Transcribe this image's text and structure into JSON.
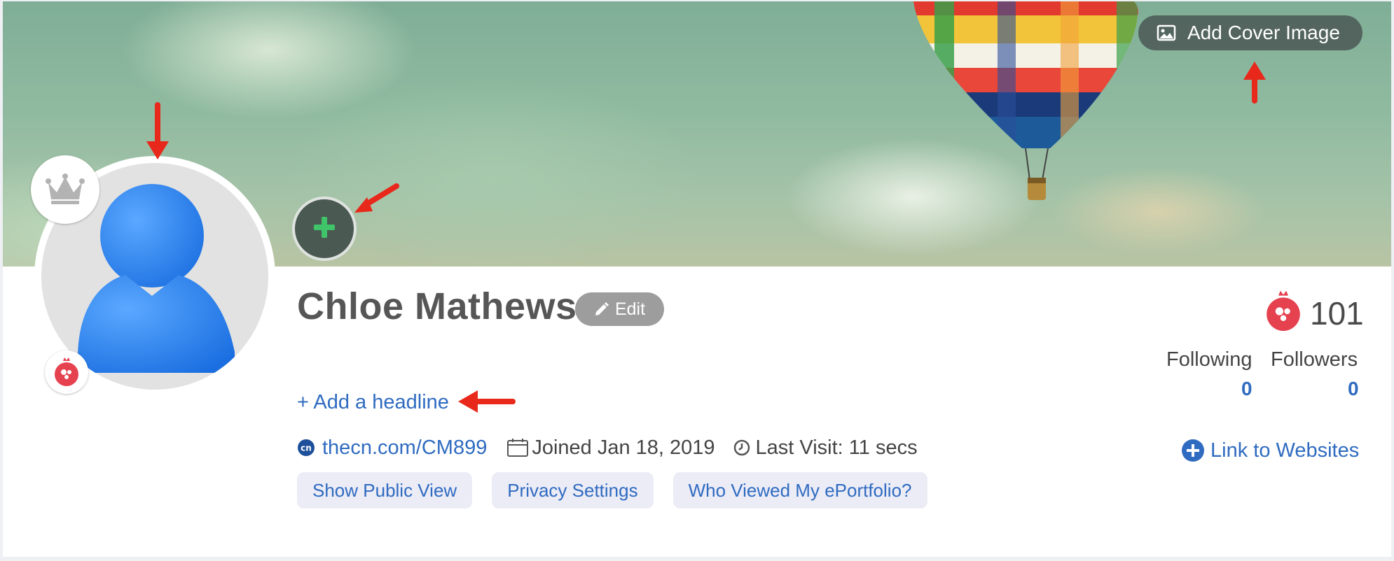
{
  "cover": {
    "add_cover_label": "Add Cover Image"
  },
  "profile": {
    "name": "Chloe Mathews",
    "edit_label": "Edit",
    "headline_label": "+ Add a headline",
    "url": "thecn.com/CM899",
    "joined": "Joined Jan 18, 2019",
    "last_visit": "Last Visit: 11 secs"
  },
  "actions": {
    "public_view": "Show Public View",
    "privacy": "Privacy Settings",
    "who_viewed": "Who Viewed My ePortfolio?"
  },
  "stats": {
    "points": "101",
    "following_label": "Following",
    "following_count": "0",
    "followers_label": "Followers",
    "followers_count": "0"
  },
  "links": {
    "websites_label": "Link to Websites"
  },
  "icons": {
    "cover": "image-icon",
    "add_photo": "plus-icon",
    "crown": "crown-icon",
    "badge": "pomegranate-icon",
    "edit": "pencil-icon",
    "cn_logo": "cn-logo-icon",
    "calendar": "calendar-icon",
    "clock": "clock-icon",
    "websites": "plus-circle-icon"
  },
  "colors": {
    "accent_blue": "#2f6bc0",
    "badge_red": "#e5414f",
    "plus_green": "#3fc46a",
    "annotation_red": "#e8281a"
  }
}
